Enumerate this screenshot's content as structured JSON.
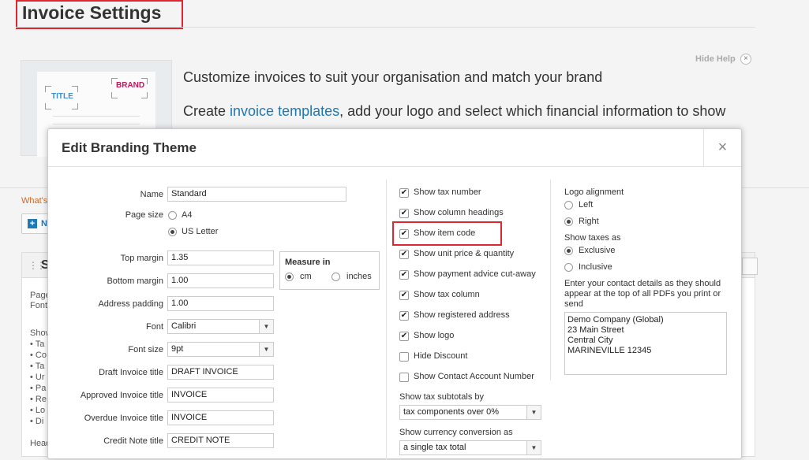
{
  "page": {
    "title": "Invoice Settings"
  },
  "help": {
    "hide_label": "Hide Help",
    "hide_close": "×",
    "illus_title": "TITLE",
    "illus_brand": "BRAND",
    "line1": "Customize invoices to suit your organisation and match your brand",
    "line2_prefix": "Create ",
    "line2_link": "invoice templates",
    "line2_suffix": ", add your logo and select which financial information to show"
  },
  "background": {
    "whats_new": "What's",
    "new_button_icon": "+",
    "new_button_text": "N",
    "panel_letter": "S",
    "fragments": [
      "Page",
      "Font",
      "Show",
      "•  Ta",
      "•  Co",
      "•  Ta",
      "•  Ur",
      "•  Pa",
      "•  Re",
      "•  Lo",
      "•  Di",
      "Head"
    ]
  },
  "modal": {
    "title": "Edit Branding Theme",
    "close": "×",
    "fields": {
      "name_label": "Name",
      "name_value": "Standard",
      "page_size_label": "Page size",
      "page_size_options": [
        "A4",
        "US Letter"
      ],
      "page_size_selected": "US Letter",
      "top_margin_label": "Top margin",
      "top_margin_value": "1.35",
      "bottom_margin_label": "Bottom margin",
      "bottom_margin_value": "1.00",
      "address_padding_label": "Address padding",
      "address_padding_value": "1.00",
      "measure_title": "Measure in",
      "measure_options": [
        "cm",
        "inches"
      ],
      "measure_selected": "cm",
      "font_label": "Font",
      "font_value": "Calibri",
      "font_size_label": "Font size",
      "font_size_value": "9pt",
      "draft_title_label": "Draft Invoice title",
      "draft_title_value": "DRAFT INVOICE",
      "approved_title_label": "Approved Invoice title",
      "approved_title_value": "INVOICE",
      "overdue_title_label": "Overdue Invoice title",
      "overdue_title_value": "INVOICE",
      "credit_note_label": "Credit Note title",
      "credit_note_value": "CREDIT NOTE"
    },
    "options": [
      {
        "label": "Show tax number",
        "checked": true
      },
      {
        "label": "Show column headings",
        "checked": true
      },
      {
        "label": "Show item code",
        "checked": true
      },
      {
        "label": "Show unit price & quantity",
        "checked": true
      },
      {
        "label": "Show payment advice cut-away",
        "checked": true
      },
      {
        "label": "Show tax column",
        "checked": true
      },
      {
        "label": "Show registered address",
        "checked": true
      },
      {
        "label": "Show logo",
        "checked": true
      },
      {
        "label": "Hide Discount",
        "checked": false
      },
      {
        "label": "Show Contact Account Number",
        "checked": false
      }
    ],
    "tax_subtotals_label": "Show tax subtotals by",
    "tax_subtotals_value": "tax components over 0%",
    "currency_conversion_label": "Show currency conversion as",
    "currency_conversion_value": "a single tax total",
    "logo_alignment_label": "Logo alignment",
    "logo_alignment_options": [
      "Left",
      "Right"
    ],
    "logo_alignment_selected": "Right",
    "show_taxes_label": "Show taxes as",
    "show_taxes_options": [
      "Exclusive",
      "Inclusive"
    ],
    "show_taxes_selected": "Exclusive",
    "contact_hint": "Enter your contact details as they should appear at the top of all PDFs you print or send",
    "contact_details": "Demo Company (Global)\n23 Main Street\nCentral City\nMARINEVILLE 12345"
  },
  "colors": {
    "highlight": "#e0262e",
    "link": "#1f77b4",
    "brand": "#c0185a",
    "accent": "#1d7ab7"
  }
}
